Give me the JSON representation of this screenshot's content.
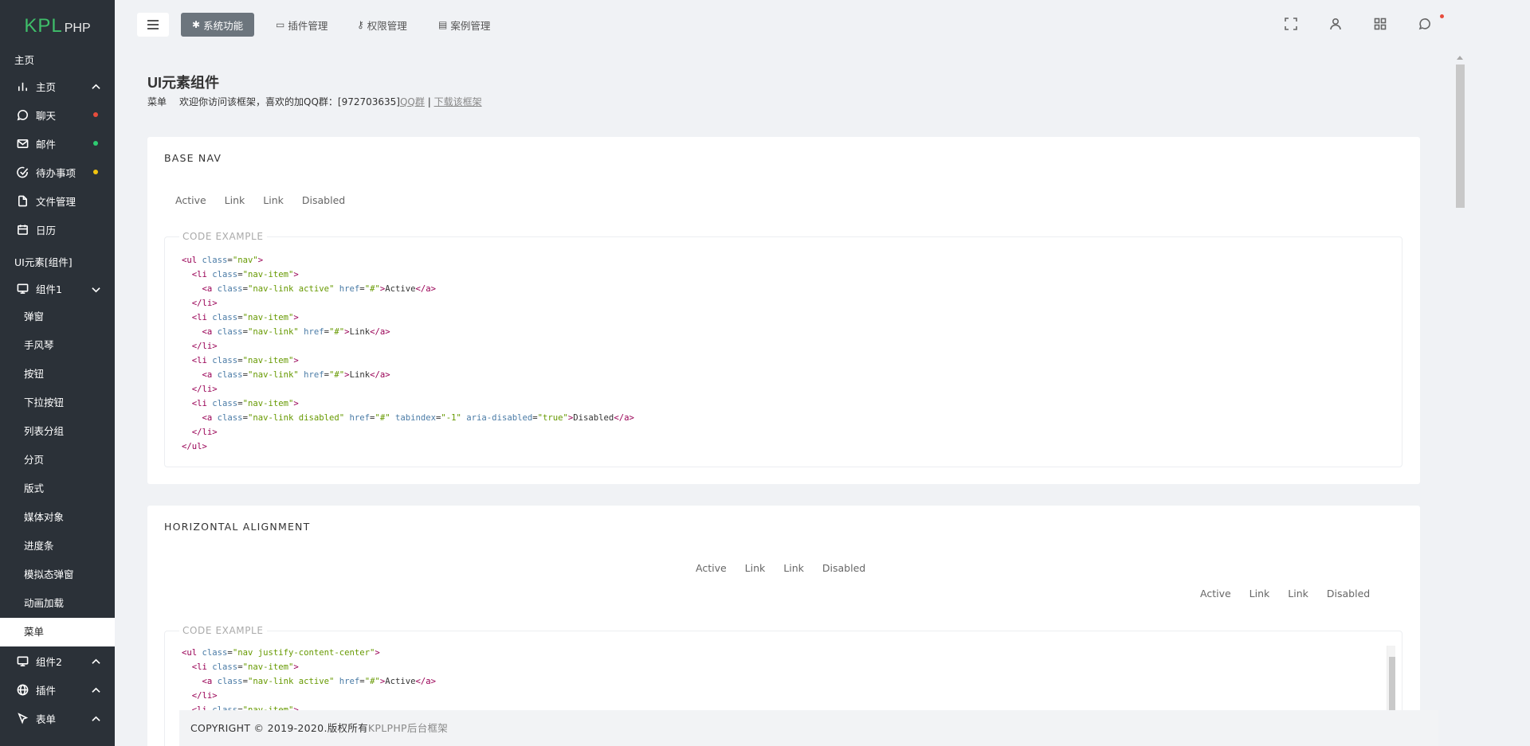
{
  "logo": {
    "main": "KPL",
    "sub": "PHP"
  },
  "sidebar": {
    "sections": [
      {
        "label": "主页"
      },
      {
        "label": "UI元素[组件]"
      }
    ],
    "items": [
      {
        "label": "主页",
        "icon": "bar-chart-icon"
      },
      {
        "label": "聊天",
        "icon": "message-circle-icon",
        "dot": "#e74c3c"
      },
      {
        "label": "邮件",
        "icon": "mail-icon",
        "dot": "#2ecc71"
      },
      {
        "label": "待办事项",
        "icon": "check-circle-icon",
        "dot": "#f1c40f"
      },
      {
        "label": "文件管理",
        "icon": "file-icon"
      },
      {
        "label": "日历",
        "icon": "calendar-icon"
      }
    ],
    "group1": {
      "label": "组件1",
      "icon": "monitor-icon"
    },
    "subitems": [
      "弹窗",
      "手风琴",
      "按钮",
      "下拉按钮",
      "列表分组",
      "分页",
      "版式",
      "媒体对象",
      "进度条",
      "模拟态弹窗",
      "动画加载",
      "菜单"
    ],
    "active_subitem": "菜单",
    "bottom": [
      {
        "label": "组件2",
        "icon": "monitor-icon"
      },
      {
        "label": "插件",
        "icon": "globe-icon"
      },
      {
        "label": "表单",
        "icon": "pointer-icon"
      }
    ]
  },
  "topnav": {
    "items": [
      "系统功能",
      "插件管理",
      "权限管理",
      "案例管理"
    ]
  },
  "page": {
    "title": "UI元素组件",
    "crumb_current": "菜单",
    "crumb_text": "欢迎你访问该框架，喜欢的加QQ群：[972703635]",
    "crumb_link1": "QQ群",
    "crumb_sep": " | ",
    "crumb_link2": "下载该框架"
  },
  "cards": [
    {
      "title": "BASE NAV",
      "nav": [
        "Active",
        "Link",
        "Link",
        "Disabled"
      ],
      "legend": "CODE EXAMPLE"
    },
    {
      "title": "HORIZONTAL ALIGNMENT",
      "nav_center": [
        "Active",
        "Link",
        "Link",
        "Disabled"
      ],
      "nav_right": [
        "Active",
        "Link",
        "Link",
        "Disabled"
      ],
      "legend": "CODE EXAMPLE"
    }
  ],
  "footer": {
    "text": "COPYRIGHT © 2019-2020.版权所有",
    "brand": "KPLPHP后台框架"
  }
}
